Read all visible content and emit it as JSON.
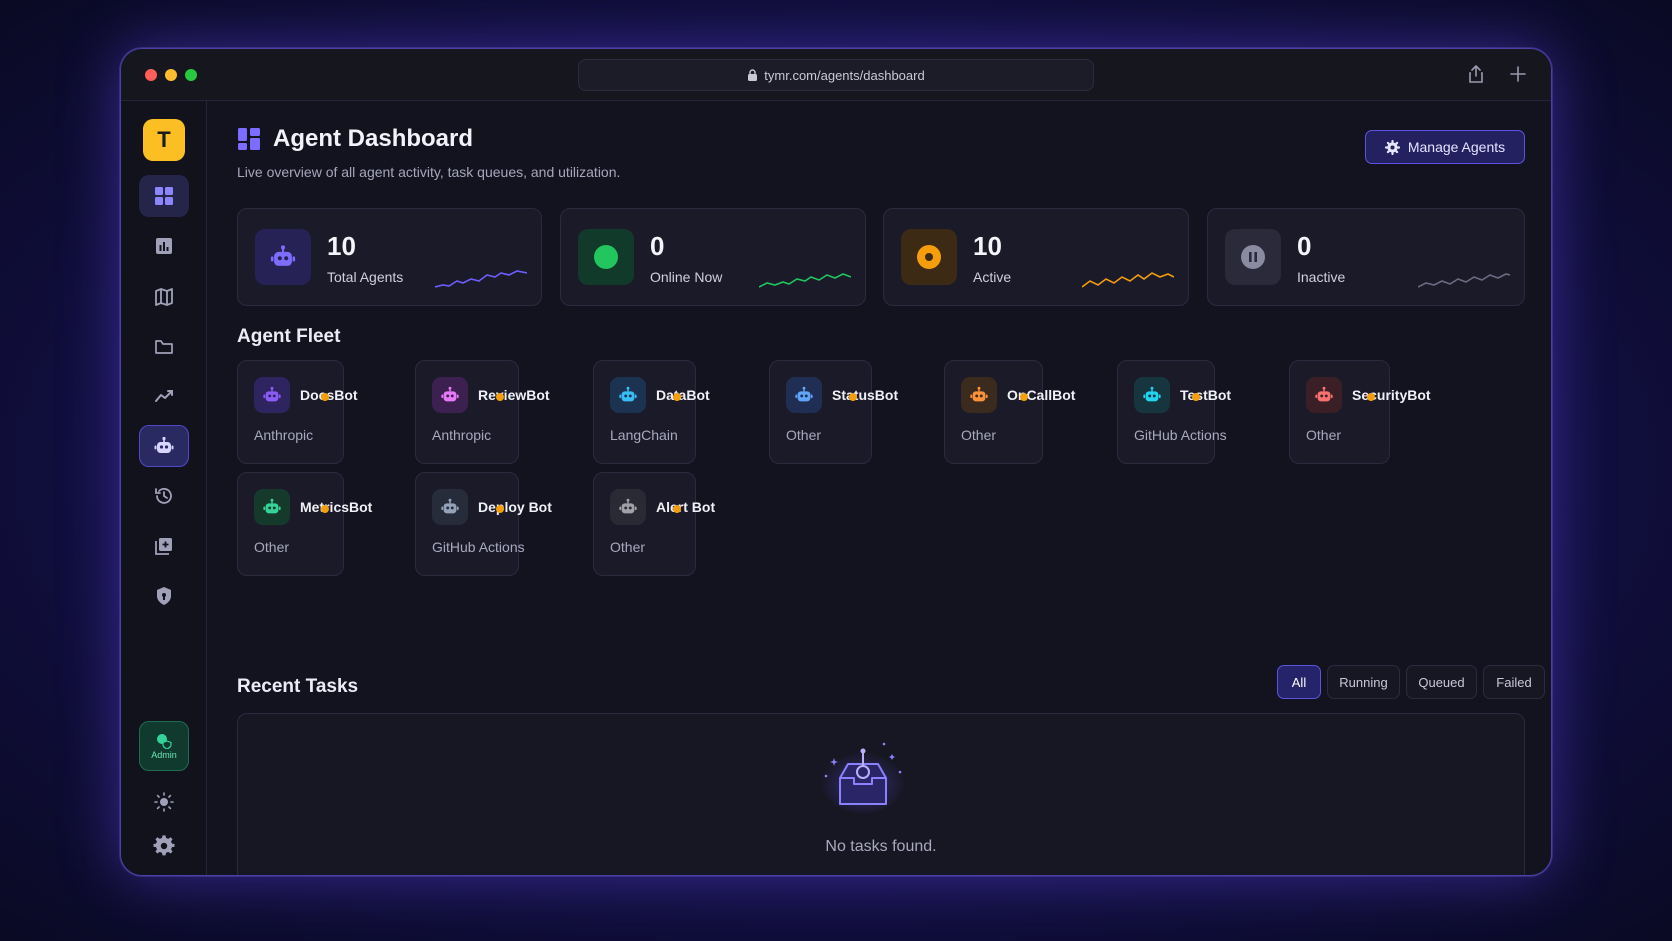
{
  "browser": {
    "url": "tymr.com/agents/dashboard"
  },
  "sidebar": {
    "logo": "T",
    "items": [
      {
        "name": "dashboard",
        "icon": "grid-icon"
      },
      {
        "name": "reports",
        "icon": "bar-chart-icon"
      },
      {
        "name": "docs",
        "icon": "book-icon"
      },
      {
        "name": "files",
        "icon": "folder-icon"
      },
      {
        "name": "analytics",
        "icon": "trend-icon"
      },
      {
        "name": "agents",
        "icon": "robot-icon"
      },
      {
        "name": "history",
        "icon": "history-icon"
      },
      {
        "name": "library",
        "icon": "library-add-icon"
      },
      {
        "name": "security",
        "icon": "shield-icon"
      }
    ],
    "admin_label": "Admin"
  },
  "header": {
    "title": "Agent Dashboard",
    "subtitle": "Live overview of all agent activity, task queues, and utilization.",
    "manage_label": "Manage Agents"
  },
  "stats": [
    {
      "value": "10",
      "label": "Total Agents",
      "color": "#7c6cff"
    },
    {
      "value": "0",
      "label": "Online Now",
      "color": "#22c55e"
    },
    {
      "value": "10",
      "label": "Active",
      "color": "#f59e0b"
    },
    {
      "value": "0",
      "label": "Inactive",
      "color": "#8a8aa0"
    }
  ],
  "fleet": {
    "title": "Agent Fleet",
    "agents": [
      {
        "name": "DocsBot",
        "provider": "Anthropic",
        "color": "#8b5cf6"
      },
      {
        "name": "ReviewBot",
        "provider": "Anthropic",
        "color": "#e879f9"
      },
      {
        "name": "DataBot",
        "provider": "LangChain",
        "color": "#38bdf8"
      },
      {
        "name": "StatusBot",
        "provider": "Other",
        "color": "#60a5fa"
      },
      {
        "name": "OnCallBot",
        "provider": "Other",
        "color": "#fb923c"
      },
      {
        "name": "TestBot",
        "provider": "GitHub Actions",
        "color": "#22d3ee"
      },
      {
        "name": "SecurityBot",
        "provider": "Other",
        "color": "#f87171"
      },
      {
        "name": "MetricsBot",
        "provider": "Other",
        "color": "#34d399"
      },
      {
        "name": "Deploy Bot",
        "provider": "GitHub Actions",
        "color": "#94a3b8"
      },
      {
        "name": "Alert Bot",
        "provider": "Other",
        "color": "#a1a1aa"
      }
    ]
  },
  "tasks": {
    "title": "Recent Tasks",
    "filters": [
      "All",
      "Running",
      "Queued",
      "Failed"
    ],
    "active_filter": "All",
    "empty_text": "No tasks found."
  }
}
